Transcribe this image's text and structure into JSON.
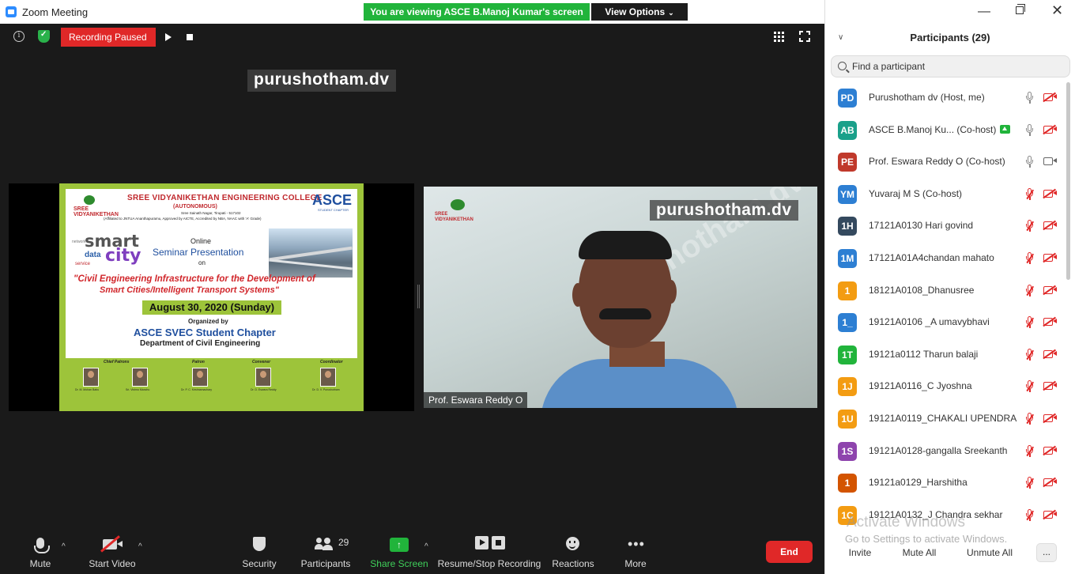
{
  "window": {
    "title": "Zoom Meeting",
    "viewing_banner": "You are viewing ASCE B.Manoj Kumar's screen",
    "view_options": "View Options",
    "minimize": "—",
    "close": "✕"
  },
  "meeting": {
    "recording_status": "Recording Paused",
    "active_speaker_label": "purushotham.dv"
  },
  "shared_poster": {
    "college": "SREE VIDYANIKETHAN ENGINEERING COLLEGE",
    "autonomous": "(AUTONOMOUS)",
    "address": "Sree Sainath Nagar, Tirupati - 517102",
    "affiliation": "(Affiliated to JNTUA Ananthapuramu, Approved by AICTE, Accredited by NBA, NAAC with 'A' Grade)",
    "logo_text": "SREE VIDYANIKETHAN",
    "asce": "ASCE",
    "asce_sub": "STUDENT CHAPTER",
    "wordcloud_smart": "smart",
    "wordcloud_city": "city",
    "wordcloud_data": "data",
    "wordcloud_network": "network",
    "wordcloud_service": "service",
    "online": "Online",
    "seminar": "Seminar Presentation",
    "on": "on",
    "topic_line1": "\"Civil Engineering Infrastructure for the Development of",
    "topic_line2": "Smart Cities/Intelligent Transport Systems\"",
    "date": "August 30, 2020 (Sunday)",
    "organized_by": "Organized by",
    "chapter": "ASCE SVEC Student Chapter",
    "department": "Department of Civil Engineering",
    "roles": [
      {
        "role": "Chief Patrons",
        "names": [
          "Dr. M. Mohan Babu",
          "Sri. Vishnu Manchu"
        ]
      },
      {
        "role": "Patron",
        "names": [
          "Dr. P. C. Krishnamachary"
        ]
      },
      {
        "role": "Convener",
        "names": [
          "Dr. D. Eswara Reddy"
        ]
      },
      {
        "role": "Coordinator",
        "names": [
          "Dr. D. V. Purushotham"
        ]
      }
    ]
  },
  "speaker_video": {
    "watermark": "purushotham.dv",
    "name": "Prof. Eswara Reddy O",
    "logo_text": "SREE VIDYANIKETHAN"
  },
  "toolbar": {
    "mute": "Mute",
    "start_video": "Start Video",
    "security": "Security",
    "participants": "Participants",
    "participants_count": "29",
    "share_screen": "Share Screen",
    "recording": "Resume/Stop Recording",
    "reactions": "Reactions",
    "more": "More",
    "end": "End"
  },
  "panel": {
    "title": "Participants (29)",
    "search_placeholder": "Find a participant",
    "participants": [
      {
        "initials": "PD",
        "name": "Purushotham dv (Host, me)",
        "color": "#2d7fd3",
        "mic": "on",
        "cam": "off"
      },
      {
        "initials": "AB",
        "name": "ASCE B.Manoj Ku...  (Co-host)",
        "color": "#1aa08a",
        "mic": "on",
        "cam": "off",
        "sharing": true
      },
      {
        "initials": "PE",
        "name": "Prof. Eswara Reddy O (Co-host)",
        "color": "#c0392b",
        "mic": "on",
        "cam": "on"
      },
      {
        "initials": "YM",
        "name": "Yuvaraj M S (Co-host)",
        "color": "#2d7fd3",
        "mic": "muted",
        "cam": "off"
      },
      {
        "initials": "1H",
        "name": "17121A0130 Hari govind",
        "color": "#34495e",
        "mic": "muted",
        "cam": "off"
      },
      {
        "initials": "1M",
        "name": "17121A01A4chandan mahato",
        "color": "#2d7fd3",
        "mic": "muted",
        "cam": "off"
      },
      {
        "initials": "1",
        "name": "18121A0108_Dhanusree",
        "color": "#f39c12",
        "mic": "muted",
        "cam": "off"
      },
      {
        "initials": "1_",
        "name": "19121A0106 _A umavybhavi",
        "color": "#2d7fd3",
        "mic": "muted",
        "cam": "off"
      },
      {
        "initials": "1T",
        "name": "19121a0112 Tharun balaji",
        "color": "#21b43b",
        "mic": "muted",
        "cam": "off"
      },
      {
        "initials": "1J",
        "name": "19121A0116_C Jyoshna",
        "color": "#f39c12",
        "mic": "muted",
        "cam": "off"
      },
      {
        "initials": "1U",
        "name": "19121A0119_CHAKALI UPENDRA",
        "color": "#f39c12",
        "mic": "muted",
        "cam": "off"
      },
      {
        "initials": "1S",
        "name": "19121A0128-gangalla Sreekanth",
        "color": "#8e44ad",
        "mic": "muted",
        "cam": "off"
      },
      {
        "initials": "1",
        "name": "19121a0129_Harshitha",
        "color": "#d35400",
        "mic": "muted",
        "cam": "off"
      },
      {
        "initials": "1C",
        "name": "19121A0132_J Chandra sekhar",
        "color": "#f39c12",
        "mic": "muted",
        "cam": "off"
      }
    ],
    "activate_title": "Activate Windows",
    "activate_sub": "Go to Settings to activate Windows.",
    "invite": "Invite",
    "mute_all": "Mute All",
    "unmute_all": "Unmute All",
    "more": "..."
  }
}
